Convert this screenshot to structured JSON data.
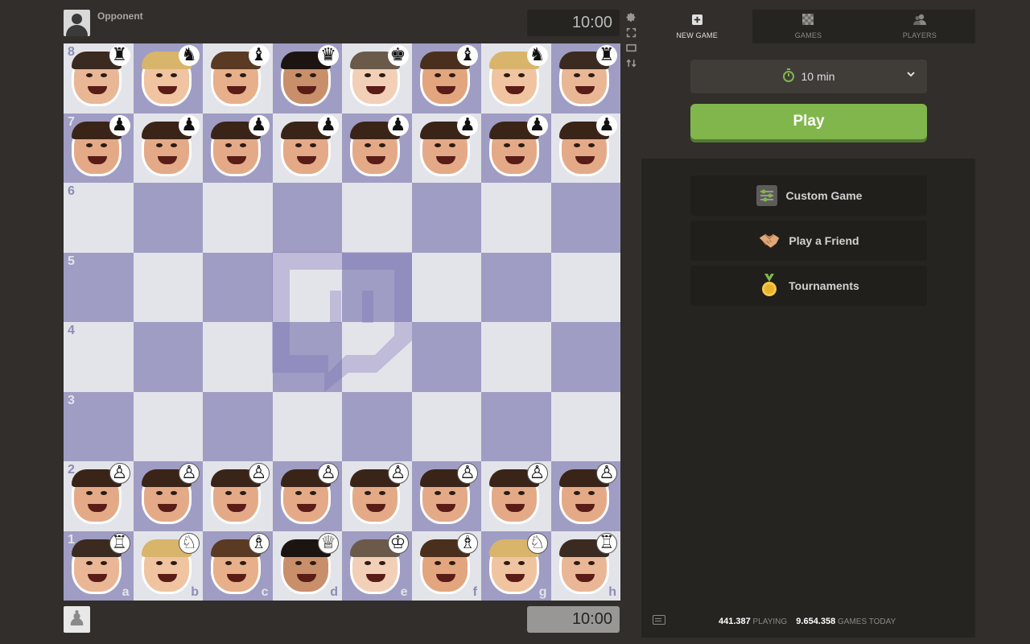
{
  "players": {
    "top": {
      "name": "Opponent",
      "clock": "10:00"
    },
    "bottom": {
      "clock": "10:00"
    }
  },
  "board_tools": [
    "gear-icon",
    "fullscreen-icon",
    "theater-icon",
    "flip-board-icon"
  ],
  "board": {
    "ranks": [
      "8",
      "7",
      "6",
      "5",
      "4",
      "3",
      "2",
      "1"
    ],
    "files": [
      "a",
      "b",
      "c",
      "d",
      "e",
      "f",
      "g",
      "h"
    ],
    "rank_label_file": "a",
    "file_label_rank": "1",
    "position": [
      [
        "br",
        "bn",
        "bb",
        "bq",
        "bk",
        "bb",
        "bn",
        "br"
      ],
      [
        "bp",
        "bp",
        "bp",
        "bp",
        "bp",
        "bp",
        "bp",
        "bp"
      ],
      [
        "",
        "",
        "",
        "",
        "",
        "",
        "",
        ""
      ],
      [
        "",
        "",
        "",
        "",
        "",
        "",
        "",
        ""
      ],
      [
        "",
        "",
        "",
        "",
        "",
        "",
        "",
        ""
      ],
      [
        "",
        "",
        "",
        "",
        "",
        "",
        "",
        ""
      ],
      [
        "wp",
        "wp",
        "wp",
        "wp",
        "wp",
        "wp",
        "wp",
        "wp"
      ],
      [
        "wr",
        "wn",
        "wb",
        "wq",
        "wk",
        "wb",
        "wn",
        "wr"
      ]
    ],
    "light_color": "#e3e4ea",
    "dark_color": "#9f9dc3",
    "watermark": "twitch-logo-watermark"
  },
  "panel": {
    "tabs": [
      {
        "label": "NEW GAME",
        "icon": "plus-square-icon",
        "active": true
      },
      {
        "label": "GAMES",
        "icon": "chessboard-icon",
        "active": false
      },
      {
        "label": "PLAYERS",
        "icon": "players-icon",
        "active": false
      }
    ],
    "time_control": "10 min",
    "play_label": "Play",
    "menu": [
      {
        "label": "Custom Game",
        "icon": "custom-game-icon"
      },
      {
        "label": "Play a Friend",
        "icon": "handshake-icon"
      },
      {
        "label": "Tournaments",
        "icon": "medal-icon"
      }
    ],
    "stats": {
      "playing_count": "441.387",
      "playing_label": "PLAYING",
      "games_count": "9.654.358",
      "games_label": "GAMES TODAY"
    }
  },
  "colors": {
    "accent": "#81b64c",
    "background": "#312e2b",
    "panel": "#262421"
  }
}
